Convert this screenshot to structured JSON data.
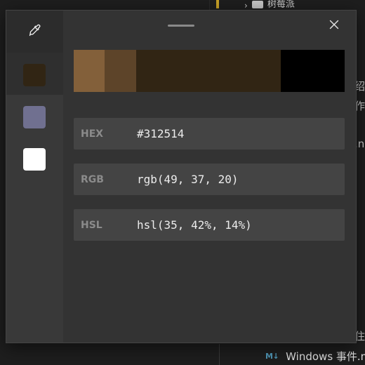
{
  "background": {
    "tree_folder": "树莓派",
    "right_fragments": [
      "绍",
      "作",
      ".n",
      "住"
    ],
    "file_badge": "M↓",
    "file_name": "Windows 事件.m"
  },
  "picker": {
    "history_colors": [
      "#312514",
      "#707090",
      "#ffffff"
    ],
    "shades": [
      {
        "color": "#83603a",
        "share": 0.115
      },
      {
        "color": "#5d4429",
        "share": 0.115
      },
      {
        "color": "#312514",
        "share": 0.534
      },
      {
        "color": "#000000",
        "share": 0.236
      }
    ],
    "fields": [
      {
        "label": "HEX",
        "value": "#312514"
      },
      {
        "label": "RGB",
        "value": "rgb(49, 37, 20)"
      },
      {
        "label": "HSL",
        "value": "hsl(35, 42%, 14%)"
      }
    ],
    "icons": {
      "eyedropper": "eyedropper-icon",
      "close": "close-icon"
    }
  }
}
